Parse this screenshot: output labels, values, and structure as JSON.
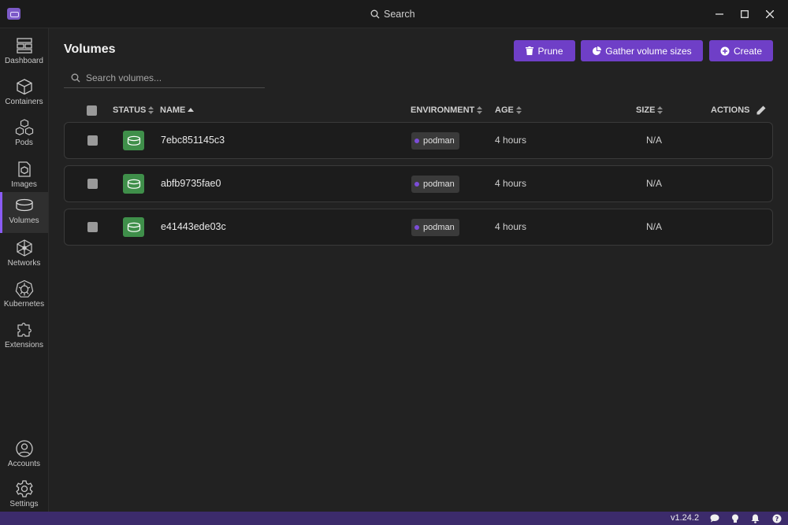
{
  "titlebar": {
    "search_label": "Search"
  },
  "sidebar": {
    "items": [
      {
        "label": "Dashboard",
        "icon": "dashboard-icon"
      },
      {
        "label": "Containers",
        "icon": "cube-icon"
      },
      {
        "label": "Pods",
        "icon": "pods-icon"
      },
      {
        "label": "Images",
        "icon": "image-icon"
      },
      {
        "label": "Volumes",
        "icon": "volume-icon",
        "active": true
      },
      {
        "label": "Networks",
        "icon": "network-icon"
      },
      {
        "label": "Kubernetes",
        "icon": "kubernetes-icon"
      },
      {
        "label": "Extensions",
        "icon": "puzzle-icon"
      }
    ],
    "bottom": [
      {
        "label": "Accounts",
        "icon": "account-icon"
      },
      {
        "label": "Settings",
        "icon": "settings-icon"
      }
    ]
  },
  "page": {
    "title": "Volumes",
    "buttons": {
      "prune": "Prune",
      "gather": "Gather volume sizes",
      "create": "Create"
    },
    "search_placeholder": "Search volumes..."
  },
  "table": {
    "columns": {
      "status": "STATUS",
      "name": "NAME",
      "environment": "ENVIRONMENT",
      "age": "AGE",
      "size": "SIZE",
      "actions": "ACTIONS"
    },
    "rows": [
      {
        "name": "7ebc851145c3",
        "environment": "podman",
        "age": "4 hours",
        "size": "N/A"
      },
      {
        "name": "abfb9735fae0",
        "environment": "podman",
        "age": "4 hours",
        "size": "N/A"
      },
      {
        "name": "e41443ede03c",
        "environment": "podman",
        "age": "4 hours",
        "size": "N/A"
      }
    ]
  },
  "statusbar": {
    "version": "v1.24.2"
  },
  "colors": {
    "accent": "#6f3fc7",
    "status_green": "#3f8f4a",
    "statusbar": "#3c2b6b",
    "env_dot": "#7c4dd8"
  }
}
